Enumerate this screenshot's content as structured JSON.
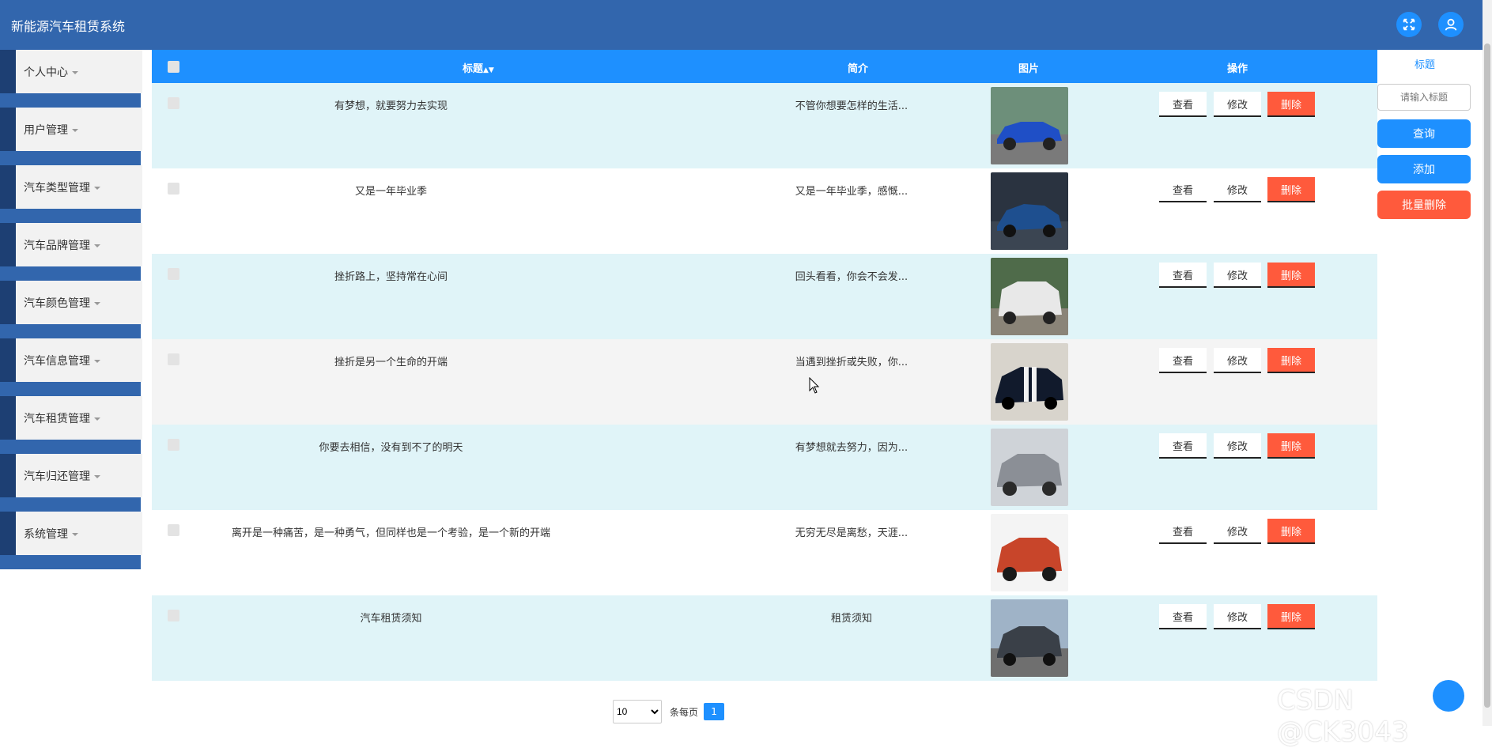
{
  "header": {
    "app_title": "新能源汽车租赁系统",
    "fullscreen_icon": "expand-icon",
    "user_icon": "user-icon"
  },
  "sidebar": {
    "items": [
      {
        "label": "个人中心"
      },
      {
        "label": "用户管理"
      },
      {
        "label": "汽车类型管理"
      },
      {
        "label": "汽车品牌管理"
      },
      {
        "label": "汽车颜色管理"
      },
      {
        "label": "汽车信息管理"
      },
      {
        "label": "汽车租赁管理"
      },
      {
        "label": "汽车归还管理"
      },
      {
        "label": "系统管理"
      }
    ]
  },
  "table": {
    "columns": {
      "title": "标题",
      "intro": "简介",
      "image": "图片",
      "actions": "操作"
    },
    "sort_icon": "sort-icon",
    "actions": {
      "view": "查看",
      "edit": "修改",
      "delete": "删除"
    },
    "rows": [
      {
        "title": "有梦想，就要努力去实现",
        "intro": "不管你想要怎样的生活...",
        "car_color": "#1f4fc6"
      },
      {
        "title": "又是一年毕业季",
        "intro": "又是一年毕业季，感慨...",
        "car_color": "#1e4f8f"
      },
      {
        "title": "挫折路上，坚持常在心间",
        "intro": "回头看看，你会不会发...",
        "car_color": "#e8e8e8"
      },
      {
        "title": "挫折是另一个生命的开端",
        "intro": "当遇到挫折或失败，你...",
        "car_color": "#111a2c"
      },
      {
        "title": "你要去相信，没有到不了的明天",
        "intro": "有梦想就去努力，因为...",
        "car_color": "#8b8f96"
      },
      {
        "title": "离开是一种痛苦，是一种勇气，但同样也是一个考验，是一个新的开端",
        "intro": "无穷无尽是离愁，天涯...",
        "car_color": "#c8452a"
      },
      {
        "title": "汽车租赁须知",
        "intro": "租赁须知",
        "car_color": "#3a4048"
      }
    ]
  },
  "pager": {
    "page_size": "10",
    "per_page_label": "条每页",
    "current_page": "1"
  },
  "search": {
    "label": "标题",
    "placeholder": "请输入标题",
    "query_label": "查询",
    "add_label": "添加",
    "batch_delete_label": "批量删除"
  },
  "watermark": "CSDN @CK3043",
  "colors": {
    "header": "#3266ad",
    "primary": "#1e90ff",
    "danger": "#ff5a3c"
  }
}
